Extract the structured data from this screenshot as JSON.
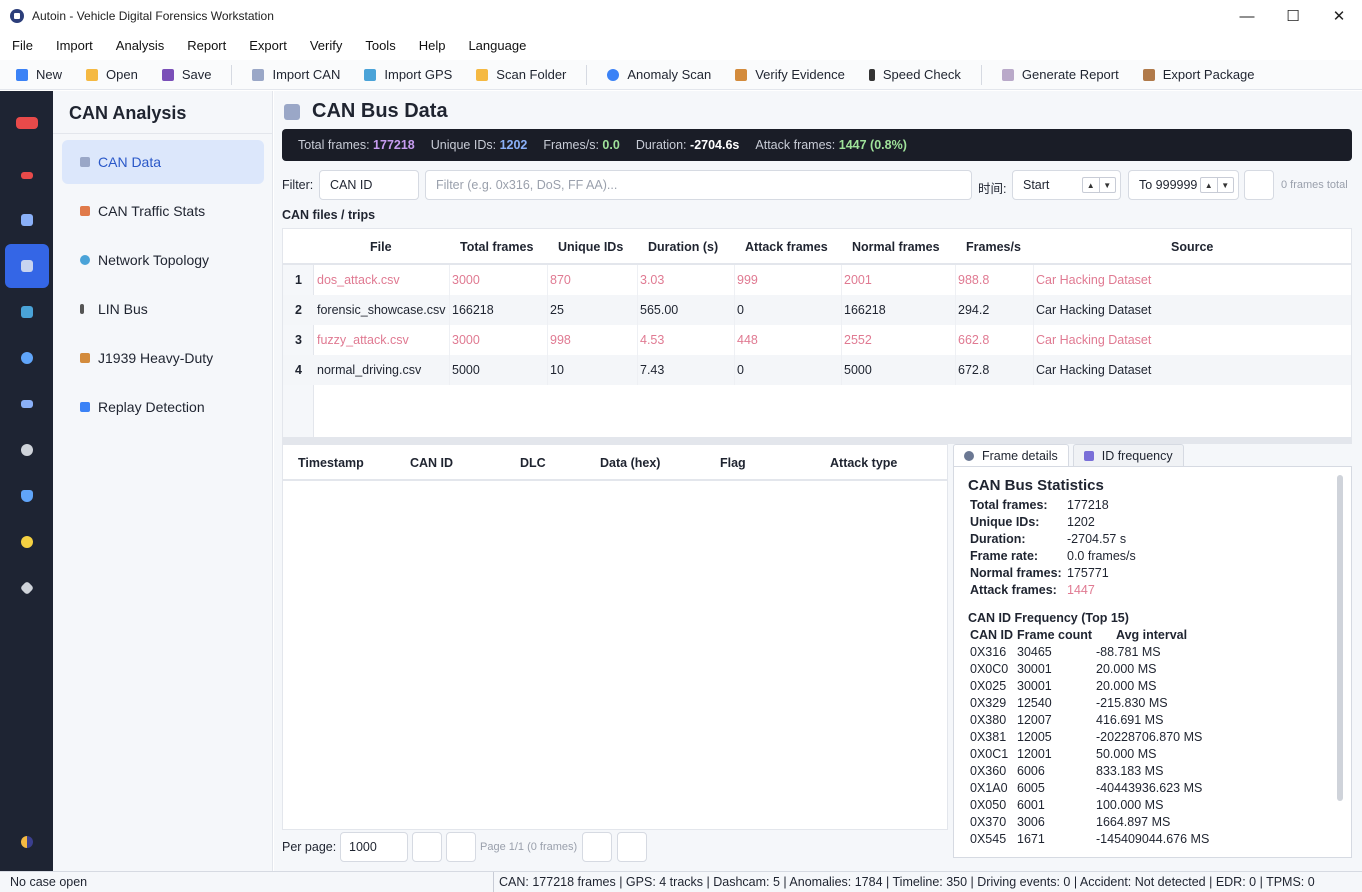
{
  "window": {
    "title": "Autoin - Vehicle Digital Forensics Workstation",
    "controls": [
      "—",
      "☐",
      "✕"
    ]
  },
  "menu": [
    "File",
    "Import",
    "Analysis",
    "Report",
    "Export",
    "Verify",
    "Tools",
    "Help",
    "Language"
  ],
  "toolbar": {
    "groups": [
      [
        {
          "label": "New",
          "icon": "new-icon",
          "color": "#3b82f6"
        },
        {
          "label": "Open",
          "icon": "folder-icon",
          "color": "#f5b942"
        },
        {
          "label": "Save",
          "icon": "save-icon",
          "color": "#7a4fb8"
        }
      ],
      [
        {
          "label": "Import CAN",
          "icon": "plug-icon",
          "color": "#9aa7c7"
        },
        {
          "label": "Import GPS",
          "icon": "map-icon",
          "color": "#4aa3d8"
        },
        {
          "label": "Scan Folder",
          "icon": "folder-icon",
          "color": "#f5b942"
        }
      ],
      [
        {
          "label": "Anomaly Scan",
          "icon": "magnifier-icon",
          "color": "#3b82f6"
        },
        {
          "label": "Verify Evidence",
          "icon": "box-icon",
          "color": "#d38b3c"
        },
        {
          "label": "Speed Check",
          "icon": "traffic-light-icon",
          "color": "#333333"
        }
      ],
      [
        {
          "label": "Generate Report",
          "icon": "report-icon",
          "color": "#b9a9c9"
        },
        {
          "label": "Export Package",
          "icon": "package-icon",
          "color": "#b07a4a"
        }
      ]
    ]
  },
  "rail": [
    {
      "icon": "car-red-icon",
      "color": "#e84a4a"
    },
    {
      "icon": "car-icon",
      "color": "#e84a4a"
    },
    {
      "icon": "camera-icon",
      "color": "#8ab0f8"
    },
    {
      "icon": "plug-icon",
      "color": "#c8d4f0",
      "active": true
    },
    {
      "icon": "map-icon",
      "color": "#4aa3d8"
    },
    {
      "icon": "search-icon",
      "color": "#60a5fa"
    },
    {
      "icon": "crash-icon",
      "color": "#8ab0f8"
    },
    {
      "icon": "gear-icon",
      "color": "#cfd3da"
    },
    {
      "icon": "shield-icon",
      "color": "#60a5fa"
    },
    {
      "icon": "bulb-icon",
      "color": "#f5d142"
    },
    {
      "icon": "wrench-icon",
      "color": "#cfd3da"
    },
    {
      "icon": "theme-icon",
      "color": "#f5b942"
    }
  ],
  "nav": {
    "title": "CAN Analysis",
    "items": [
      {
        "label": "CAN Data",
        "icon": "plug-icon",
        "color": "#9aa7c7",
        "active": true
      },
      {
        "label": "CAN Traffic Stats",
        "icon": "chart-icon",
        "color": "#e07a4a"
      },
      {
        "label": "Network Topology",
        "icon": "globe-icon",
        "color": "#4aa3d8"
      },
      {
        "label": "LIN Bus",
        "icon": "pin-icon",
        "color": "#555555"
      },
      {
        "label": "J1939 Heavy-Duty",
        "icon": "truck-icon",
        "color": "#d38b3c"
      },
      {
        "label": "Replay Detection",
        "icon": "replay-icon",
        "color": "#3b82f6"
      }
    ]
  },
  "main": {
    "title": "CAN Bus Data",
    "stats": {
      "total_label": "Total frames:",
      "total": "177218",
      "unique_label": "Unique IDs:",
      "unique": "1202",
      "fps_label": "Frames/s:",
      "fps": "0.0",
      "duration_label": "Duration:",
      "duration": "-2704.6s",
      "attack_label": "Attack frames:",
      "attack": "1447 (0.8%)"
    },
    "filter": {
      "label": "Filter:",
      "field": "CAN ID",
      "placeholder": "Filter (e.g. 0x316, DoS, FF AA)...",
      "time_label": "时间:",
      "start": "Start",
      "end": "To 999999",
      "count": "0 frames total"
    },
    "files_label": "CAN files / trips",
    "files": {
      "columns": [
        "File",
        "Total frames",
        "Unique IDs",
        "Duration (s)",
        "Attack frames",
        "Normal frames",
        "Frames/s",
        "Source"
      ],
      "rows": [
        {
          "num": "1",
          "cells": [
            "dos_attack.csv",
            "3000",
            "870",
            "3.03",
            "999",
            "2001",
            "988.8",
            "Car Hacking Dataset"
          ],
          "attack": true
        },
        {
          "num": "2",
          "cells": [
            "forensic_showcase.csv",
            "166218",
            "25",
            "565.00",
            "0",
            "166218",
            "294.2",
            "Car Hacking Dataset"
          ],
          "attack": false
        },
        {
          "num": "3",
          "cells": [
            "fuzzy_attack.csv",
            "3000",
            "998",
            "4.53",
            "448",
            "2552",
            "662.8",
            "Car Hacking Dataset"
          ],
          "attack": true
        },
        {
          "num": "4",
          "cells": [
            "normal_driving.csv",
            "5000",
            "10",
            "7.43",
            "0",
            "5000",
            "672.8",
            "Car Hacking Dataset"
          ],
          "attack": false
        }
      ]
    },
    "frames": {
      "columns": [
        "Timestamp",
        "CAN ID",
        "DLC",
        "Data (hex)",
        "Flag",
        "Attack type"
      ]
    },
    "pager": {
      "label": "Per page:",
      "value": "1000",
      "info": "Page 1/1 (0 frames)"
    },
    "details": {
      "tabs": [
        {
          "label": "Frame details",
          "icon": "search-icon",
          "active": true
        },
        {
          "label": "ID frequency",
          "icon": "chart-icon",
          "active": false
        }
      ],
      "title": "CAN Bus Statistics",
      "stats": [
        {
          "k": "Total frames:",
          "v": "177218"
        },
        {
          "k": "Unique IDs:",
          "v": "1202"
        },
        {
          "k": "Duration:",
          "v": "-2704.57 s"
        },
        {
          "k": "Frame rate:",
          "v": "0.0 frames/s"
        },
        {
          "k": "Normal frames:",
          "v": "175771"
        },
        {
          "k": "Attack frames:",
          "v": "1447",
          "attack": true
        }
      ],
      "freq_title": "CAN ID Frequency (Top 15)",
      "freq_columns": [
        "CAN ID",
        "Frame count",
        "Avg interval"
      ],
      "freq_rows": [
        [
          "0X316",
          "30465",
          "-88.781 MS"
        ],
        [
          "0X0C0",
          "30001",
          "20.000 MS"
        ],
        [
          "0X025",
          "30001",
          "20.000 MS"
        ],
        [
          "0X329",
          "12540",
          "-215.830 MS"
        ],
        [
          "0X380",
          "12007",
          "416.691 MS"
        ],
        [
          "0X381",
          "12005",
          "-20228706.870 MS"
        ],
        [
          "0X0C1",
          "12001",
          "50.000 MS"
        ],
        [
          "0X360",
          "6006",
          "833.183 MS"
        ],
        [
          "0X1A0",
          "6005",
          "-40443936.623 MS"
        ],
        [
          "0X050",
          "6001",
          "100.000 MS"
        ],
        [
          "0X370",
          "3006",
          "1664.897 MS"
        ],
        [
          "0X545",
          "1671",
          "-145409044.676 MS"
        ]
      ]
    }
  },
  "status": {
    "left": "No case open",
    "right": "CAN: 177218 frames | GPS: 4 tracks | Dashcam: 5 | Anomalies: 1784 | Timeline: 350 | Driving events: 0 | Accident: Not detected | EDR: 0 | TPMS: 0"
  }
}
